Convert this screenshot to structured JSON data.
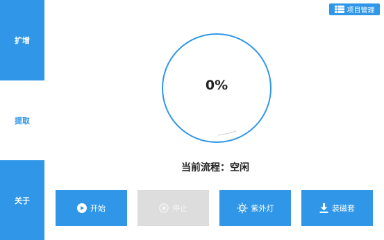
{
  "sidebar": {
    "items": [
      {
        "label": "扩增"
      },
      {
        "label": "提取"
      },
      {
        "label": "关于"
      }
    ]
  },
  "header": {
    "project_button": "项目管理",
    "project_icon": "list-icon"
  },
  "progress": {
    "percent_text": "0%",
    "value": 0
  },
  "status": {
    "text": "当前流程：空闲"
  },
  "actions": [
    {
      "label": "开始",
      "icon": "play-icon",
      "enabled": true
    },
    {
      "label": "停止",
      "icon": "stop-icon",
      "enabled": false
    },
    {
      "label": "紫外灯",
      "icon": "uv-lamp-icon",
      "enabled": true
    },
    {
      "label": "装磁套",
      "icon": "download-icon",
      "enabled": true
    }
  ],
  "colors": {
    "accent": "#2f96e8",
    "disabled": "#dddddd",
    "text": "#222222"
  }
}
